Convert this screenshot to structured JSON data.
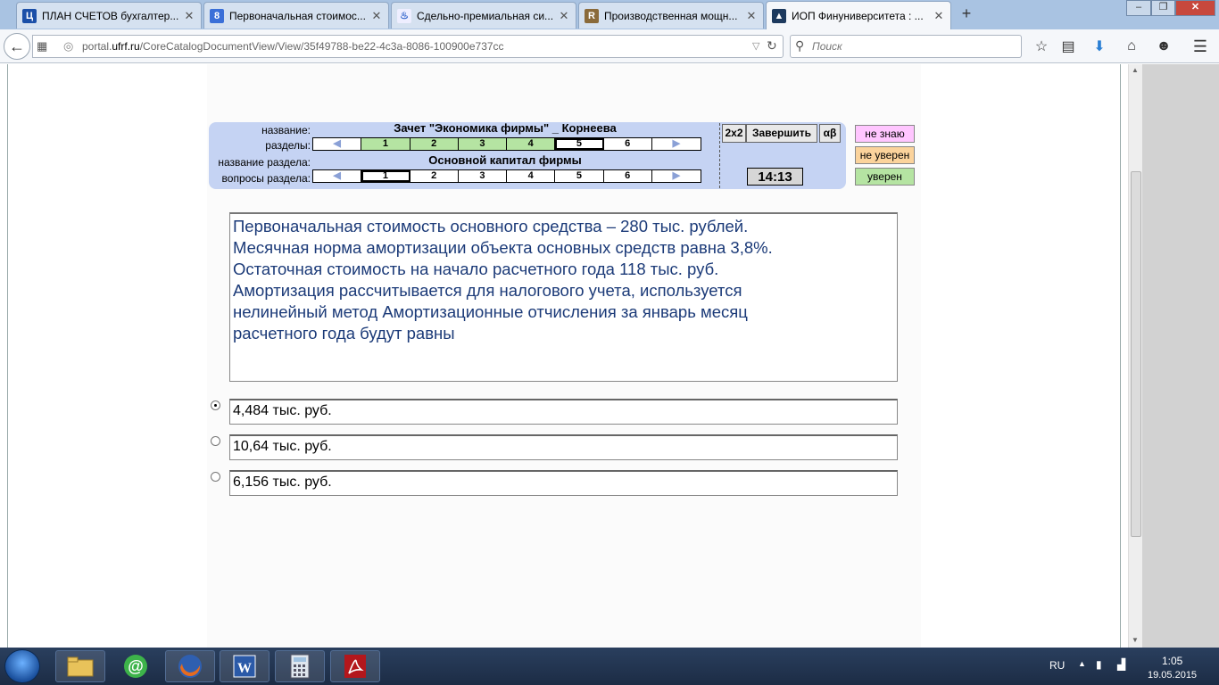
{
  "browser": {
    "tabs": [
      {
        "icon": "tab-favicon-letter-ц",
        "glyph": "Ц",
        "color": "#1b4fa8",
        "title": "ПЛАН СЧЕТОВ бухгалтер..."
      },
      {
        "icon": "tab-favicon-g",
        "glyph": "8",
        "color": "#3a6fd8",
        "title": "Первоначальная стоимос..."
      },
      {
        "icon": "tab-favicon-flask",
        "glyph": "⚗",
        "color": "#5a78c8",
        "title": "Сдельно-премиальная си..."
      },
      {
        "icon": "tab-favicon-r",
        "glyph": "R",
        "color": "#8a6a3a",
        "title": "Производственная мощн..."
      },
      {
        "icon": "tab-favicon-cap",
        "glyph": "🎓",
        "color": "#333333",
        "title": "ИОП Финуниверситета : ..."
      }
    ],
    "url_prefix": "portal.",
    "url_host": "ufrf.ru",
    "url_path": "/CoreCatalogDocumentView/View/35f49788-be22-4c3a-8086-100900e737cc",
    "search_placeholder": "Поиск"
  },
  "test": {
    "label_name": "название:",
    "label_sections": "разделы:",
    "label_section_name": "название раздела:",
    "label_questions": "вопросы раздела:",
    "test_title": "Зачет \"Экономика фирмы\" _ Корнеева",
    "section_title": "Основной капитал фирмы",
    "sections": [
      "1",
      "2",
      "3",
      "4",
      "5",
      "6"
    ],
    "questions": [
      "1",
      "2",
      "3",
      "4",
      "5",
      "6"
    ],
    "btn_2x2": "2x2",
    "btn_finish": "Завершить",
    "btn_ab": "αβ",
    "timer": "14:13",
    "conf_dont_know": "не знаю",
    "conf_unsure": "не уверен",
    "conf_sure": "уверен",
    "colors": {
      "done": "#b5e4a2",
      "panel": "#c5d3f3",
      "dont_know": "#ffc6ff",
      "unsure": "#fbd39c",
      "sure": "#b5e4a2"
    }
  },
  "question": {
    "text": "Первоначальная стоимость основного средства – 280 тыс. рублей.\nМесячная норма амортизации объекта основных средств равна 3,8%.\nОстаточная стоимость на начало расчетного года 118 тыс. руб.\nАмортизация рассчитывается для налогового учета, используется\nнелинейный метод Амортизационные отчисления за январь месяц\nрасчетного года будут равны"
  },
  "answers": [
    {
      "text": "4,484 тыс. руб.",
      "selected": true
    },
    {
      "text": "10,64 тыс. руб.",
      "selected": false
    },
    {
      "text": "6,156 тыс. руб.",
      "selected": false
    }
  ],
  "taskbar": {
    "lang": "RU",
    "time": "1:05",
    "date": "19.05.2015",
    "items": [
      "folder-icon",
      "mail-ru-agent-icon",
      "firefox-icon",
      "word-icon",
      "calculator-icon",
      "acrobat-icon"
    ]
  }
}
